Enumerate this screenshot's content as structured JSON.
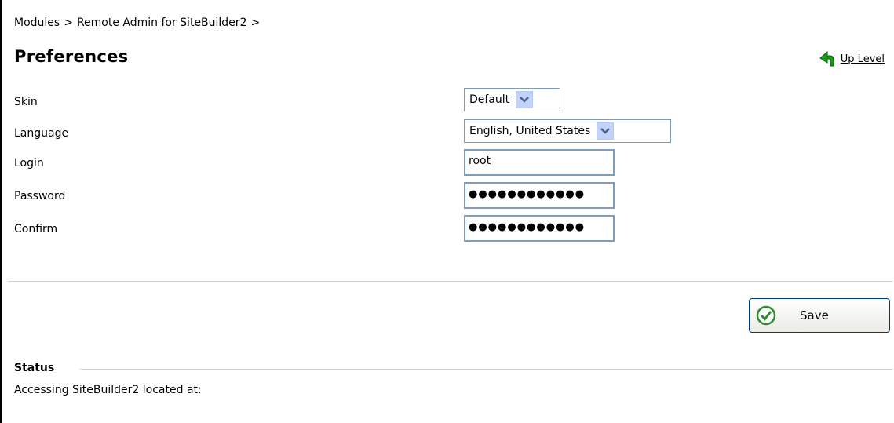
{
  "breadcrumb": {
    "modules": "Modules",
    "separator": ">",
    "remote_admin": "Remote Admin for SiteBuilder2"
  },
  "page_title": "Preferences",
  "up_level": {
    "label": "Up Level",
    "icon": "up-arrow-icon",
    "color": "#008000"
  },
  "form": {
    "skin": {
      "label": "Skin",
      "value": "Default"
    },
    "language": {
      "label": "Language",
      "value": "English, United States"
    },
    "login": {
      "label": "Login",
      "value": "root"
    },
    "password": {
      "label": "Password",
      "value": "●●●●●●●●●●●●"
    },
    "confirm": {
      "label": "Confirm",
      "value": "●●●●●●●●●●●●"
    }
  },
  "save_button": {
    "label": "Save",
    "icon": "checkmark-icon"
  },
  "status": {
    "label": "Status",
    "text": "Accessing SiteBuilder2 located at:"
  }
}
